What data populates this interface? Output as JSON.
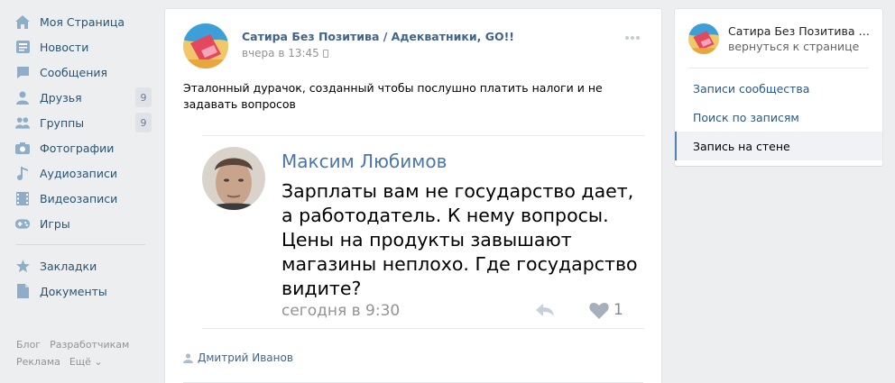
{
  "nav": {
    "items": [
      {
        "label": "Моя Страница",
        "icon": "home-icon"
      },
      {
        "label": "Новости",
        "icon": "news-icon"
      },
      {
        "label": "Сообщения",
        "icon": "messages-icon"
      },
      {
        "label": "Друзья",
        "icon": "friends-icon",
        "count": "9"
      },
      {
        "label": "Группы",
        "icon": "groups-icon",
        "count": "9"
      },
      {
        "label": "Фотографии",
        "icon": "camera-icon"
      },
      {
        "label": "Аудиозаписи",
        "icon": "music-icon"
      },
      {
        "label": "Видеозаписи",
        "icon": "video-icon"
      },
      {
        "label": "Игры",
        "icon": "gamepad-icon"
      }
    ],
    "items2": [
      {
        "label": "Закладки",
        "icon": "star-icon"
      },
      {
        "label": "Документы",
        "icon": "document-icon"
      }
    ],
    "footer": {
      "blog": "Блог",
      "dev": "Разработчикам",
      "ads": "Реклама",
      "more": "Ещё ⌄"
    }
  },
  "post": {
    "author": "Сатира Без Позитива / Адекватники, GO!!",
    "date": "вчера в 13:45",
    "text": "Эталонный дурачок, созданный чтобы послушно платить налоги и не задавать вопросов",
    "signer": "Дмитрий Иванов",
    "embed": {
      "name": "Максим Любимов",
      "text": "Зарплаты вам не государство дает, а работодатель. К нему вопросы. Цены на продукты завышают магазины неплохо. Где государство видите?",
      "date": "сегодня в 9:30",
      "likes": "1"
    }
  },
  "panel": {
    "title": "Сатира Без Позитива / Адекватники, GO!!",
    "back": "вернуться к странице",
    "links": [
      "Записи сообщества",
      "Поиск по записям",
      "Запись на стене"
    ],
    "active_index": 2
  },
  "colors": {
    "link": "#42648b",
    "accent": "#5181b8",
    "background": "#edeef0"
  }
}
